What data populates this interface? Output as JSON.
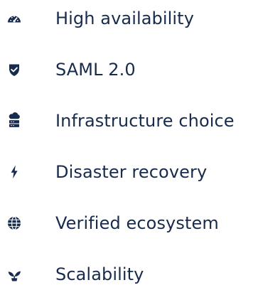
{
  "features": [
    {
      "label": "High availability",
      "icon": "speedometer-icon"
    },
    {
      "label": "SAML 2.0",
      "icon": "shield-check-icon"
    },
    {
      "label": "Infrastructure choice",
      "icon": "cloud-server-icon"
    },
    {
      "label": "Disaster recovery",
      "icon": "lightning-icon"
    },
    {
      "label": "Verified ecosystem",
      "icon": "globe-icon"
    },
    {
      "label": "Scalability",
      "icon": "sprout-icon"
    }
  ],
  "colors": {
    "icon": "#172b4d",
    "text": "#172b4d"
  }
}
